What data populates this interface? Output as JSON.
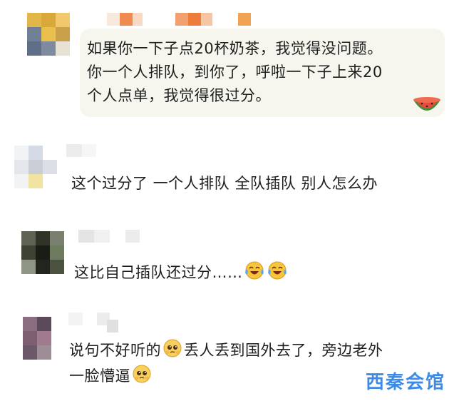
{
  "comments": [
    {
      "lines": [
        "如果你一下子点20杯奶茶，我觉得没问题。",
        "你一个人排队，到你了，呼啦一下子上来20",
        "个人点单，我觉得很过分。"
      ],
      "sticker": "watermelon-sticker"
    },
    {
      "lines": [
        "这个过分了 一个人排队 全队插队 别人怎么办"
      ]
    },
    {
      "lines": [
        "这比自己插队还过分……"
      ],
      "emojis": [
        "laughing-crying-emoji",
        "laughing-crying-emoji"
      ]
    },
    {
      "lines": [
        "说句不好听的",
        "丢人丢到国外去了，旁边老外",
        "一脸懵逼"
      ],
      "emojis": [
        "pleading-emoji",
        "pleading-emoji"
      ]
    }
  ],
  "watermark": "西秦会馆",
  "colors": {
    "bubble": "#f6f6ef",
    "text": "#1e1e1e",
    "watermark": "#3d8be8"
  }
}
